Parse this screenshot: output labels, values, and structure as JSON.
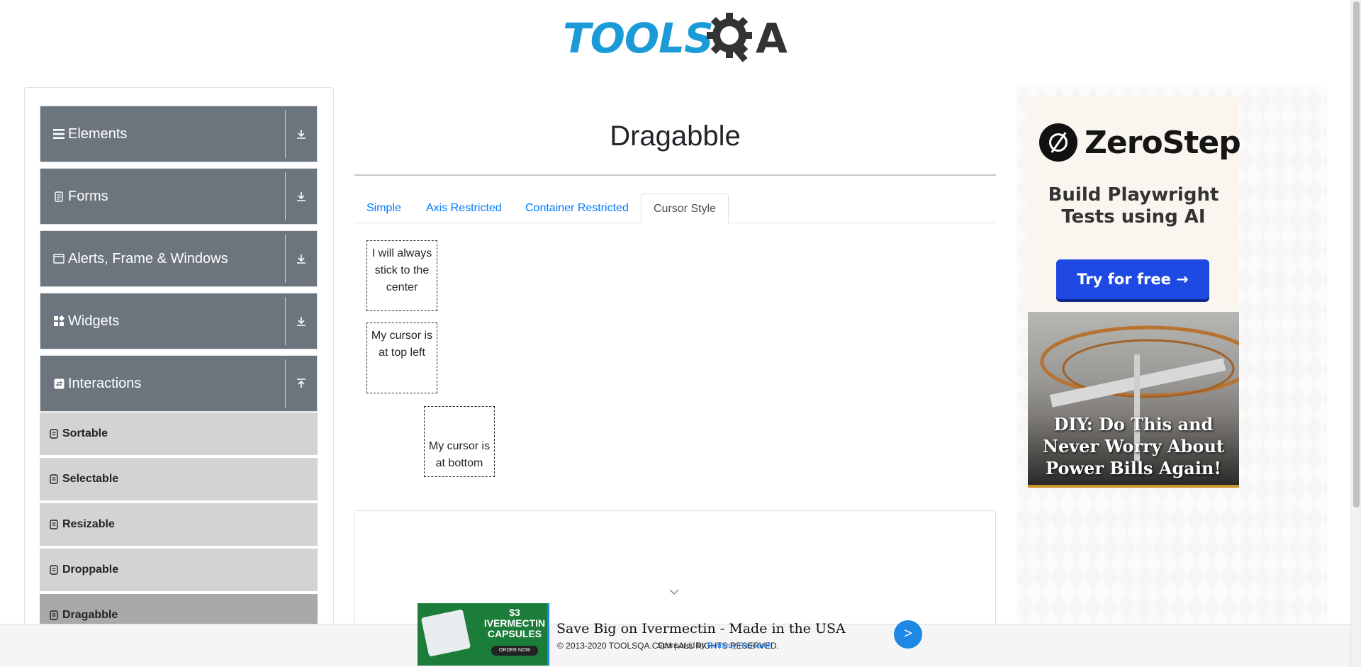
{
  "header": {
    "logo_text_left": "TOOLS",
    "logo_text_right": "A"
  },
  "sidebar": {
    "groups": [
      {
        "label": "Elements",
        "icon": "menu-icon",
        "state": "collapsed"
      },
      {
        "label": "Forms",
        "icon": "form-icon",
        "state": "collapsed"
      },
      {
        "label": "Alerts, Frame & Windows",
        "icon": "window-icon",
        "state": "collapsed"
      },
      {
        "label": "Widgets",
        "icon": "widgets-icon",
        "state": "collapsed"
      },
      {
        "label": "Interactions",
        "icon": "interactions-icon",
        "state": "expanded"
      }
    ],
    "items": [
      {
        "label": "Sortable",
        "active": false
      },
      {
        "label": "Selectable",
        "active": false
      },
      {
        "label": "Resizable",
        "active": false
      },
      {
        "label": "Droppable",
        "active": false
      },
      {
        "label": "Dragabble",
        "active": true
      }
    ]
  },
  "main": {
    "title": "Dragabble",
    "tabs": [
      {
        "label": "Simple",
        "active": false
      },
      {
        "label": "Axis Restricted",
        "active": false
      },
      {
        "label": "Container Restricted",
        "active": false
      },
      {
        "label": "Cursor Style",
        "active": true
      }
    ],
    "boxes": [
      {
        "label": "I will always stick to the center"
      },
      {
        "label": "My cursor is at top left"
      },
      {
        "label": "My cursor is at bottom"
      }
    ]
  },
  "right_ad": {
    "brand": "ZeroStep",
    "tagline": "Build Playwright Tests using AI",
    "button": "Try for free →",
    "promo": "DIY: Do This and Never Worry About Power Bills Again!"
  },
  "bottom_ad": {
    "price": "$3 IVERMECTIN CAPSULES",
    "order": "ORDER NOW",
    "headline": "Save Big on Ivermectin - Made in the USA",
    "sponsor_prefix": "Sponsored by",
    "sponsor_name": "Remedy Research",
    "go": ">"
  },
  "footer": {
    "text": "© 2013-2020 TOOLSQA.COM | ALL RIGHTS RESERVED."
  },
  "colors": {
    "group_bg": "#6c757d",
    "item_bg": "#d3d3d3",
    "active_item_bg": "#a9a9a9",
    "link": "#007bff",
    "logo_blue": "#1a9ad6"
  }
}
